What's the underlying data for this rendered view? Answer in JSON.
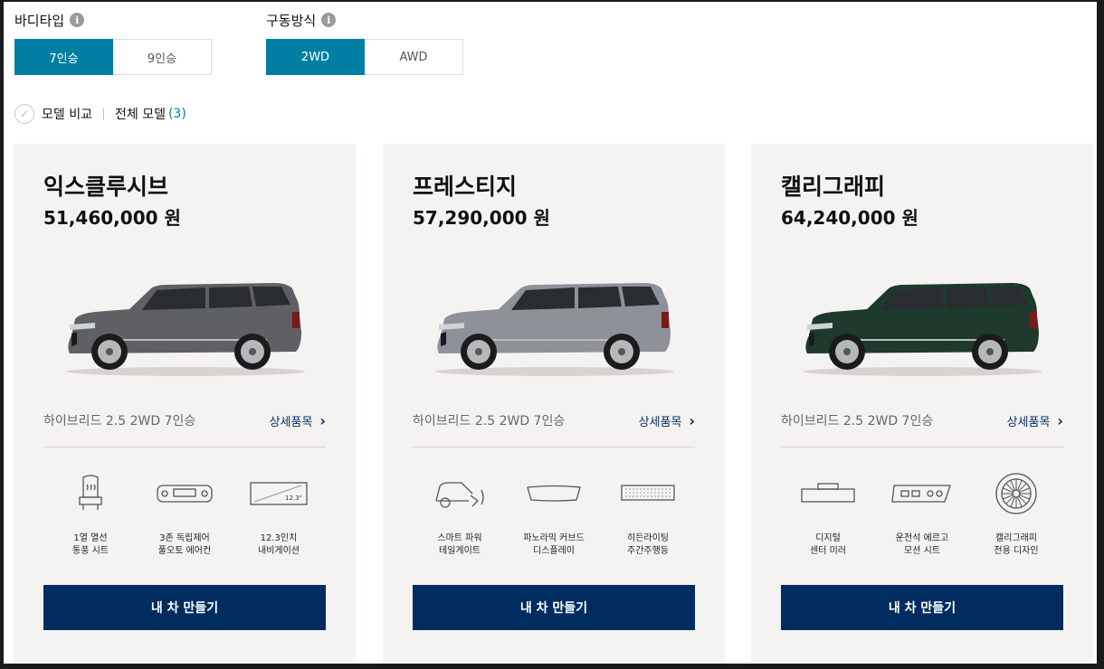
{
  "filters": {
    "body_type": {
      "label": "바디타입",
      "options": [
        "7인승",
        "9인승"
      ],
      "selected": "7인승"
    },
    "drive_type": {
      "label": "구동방식",
      "options": [
        "2WD",
        "AWD"
      ],
      "selected": "2WD"
    }
  },
  "compare": {
    "label": "모델 비교",
    "all_models_label": "전체 모델",
    "count": "(3)"
  },
  "cards": [
    {
      "name": "익스클루시브",
      "price": "51,460,000 원",
      "car_color": "#5f6063",
      "spec": "하이브리드 2.5 2WD 7인승",
      "detail_label": "상세품목",
      "features": [
        {
          "icon": "heated-seat-icon",
          "label": "1열 열선\n통풍 시트"
        },
        {
          "icon": "climate-control-icon",
          "label": "3존 독립제어\n풀오토 에어컨"
        },
        {
          "icon": "navigation-screen-icon",
          "label": "12.3인치\n내비게이션",
          "badge": "12.3\""
        }
      ],
      "button": "내 차 만들기"
    },
    {
      "name": "프레스티지",
      "price": "57,290,000 원",
      "car_color": "#8e9298",
      "spec": "하이브리드 2.5 2WD 7인승",
      "detail_label": "상세품목",
      "features": [
        {
          "icon": "power-tailgate-icon",
          "label": "스마트 파워\n테일게이트"
        },
        {
          "icon": "curved-display-icon",
          "label": "파노라믹 커브드\n디스플레이"
        },
        {
          "icon": "daytime-light-icon",
          "label": "히든라이팅\n주간주행등"
        }
      ],
      "button": "내 차 만들기"
    },
    {
      "name": "캘리그래피",
      "price": "64,240,000 원",
      "car_color": "#1d3a2c",
      "spec": "하이브리드 2.5 2WD 7인승",
      "detail_label": "상세품목",
      "features": [
        {
          "icon": "digital-mirror-icon",
          "label": "디지털\n센터 미러"
        },
        {
          "icon": "ergo-seat-icon",
          "label": "운전석 에르고\n모션 시트"
        },
        {
          "icon": "calligraphy-wheel-icon",
          "label": "캘리그래피\n전용 디자인"
        }
      ],
      "button": "내 차 만들기"
    }
  ]
}
